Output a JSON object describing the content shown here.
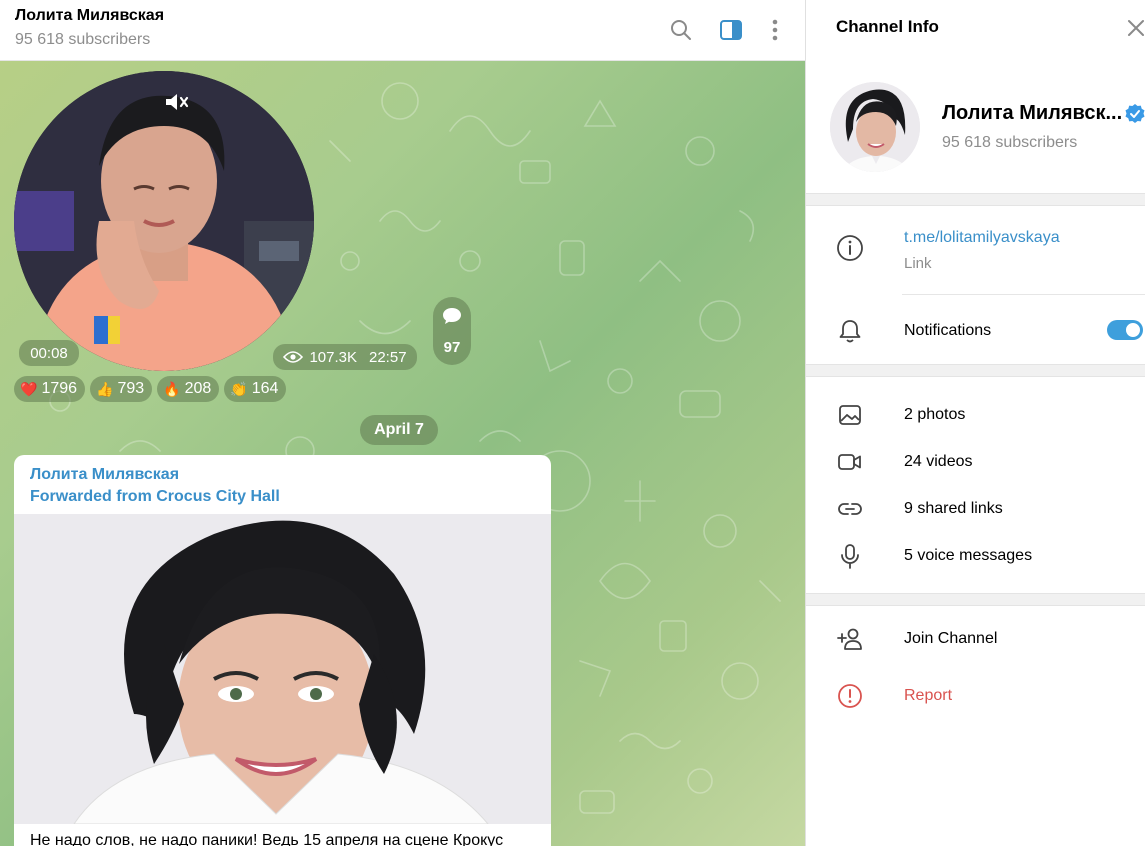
{
  "chat": {
    "title": "Лолита Милявская",
    "subscribers": "95 618 subscribers"
  },
  "video_message": {
    "duration": "00:08",
    "views": "107.3K",
    "time": "22:57",
    "comments": "97"
  },
  "reactions": [
    {
      "emoji": "❤️",
      "count": "1796"
    },
    {
      "emoji": "👍",
      "count": "793"
    },
    {
      "emoji": "🔥",
      "count": "208"
    },
    {
      "emoji": "👏",
      "count": "164"
    }
  ],
  "date_separator": "April 7",
  "post": {
    "author": "Лолита Милявская",
    "forwarded": "Forwarded from Crocus City Hall",
    "text": "Не надо слов, не надо паники! Ведь 15 апреля на сцене Крокус"
  },
  "info": {
    "title": "Channel Info",
    "name": "Лолита Милявск...",
    "subscribers": "95 618 subscribers",
    "link": "t.me/lolitamilyavskaya",
    "link_caption": "Link",
    "notifications": "Notifications",
    "notifications_on": true,
    "media": {
      "photos": "2 photos",
      "videos": "24 videos",
      "links": "9 shared links",
      "voice": "5 voice messages"
    },
    "join": "Join Channel",
    "report": "Report"
  },
  "colors": {
    "accent": "#3a8fc9",
    "toggle": "#3e9fdc",
    "danger": "#d9534f"
  }
}
